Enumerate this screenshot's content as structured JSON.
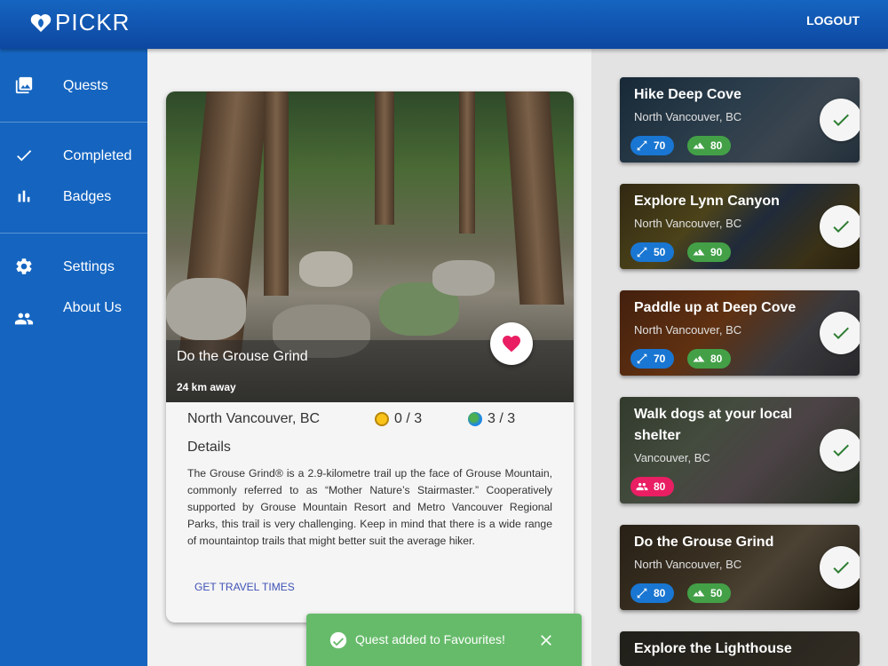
{
  "app": {
    "name": "PICKR",
    "logout": "LOGOUT"
  },
  "sidebar": {
    "items": [
      {
        "label": "Quests",
        "icon": "photo-library-icon"
      },
      {
        "label": "Completed",
        "icon": "check-icon"
      },
      {
        "label": "Badges",
        "icon": "bar-chart-icon"
      },
      {
        "label": "Settings",
        "icon": "gear-icon"
      },
      {
        "label": "About Us",
        "icon": "people-icon"
      }
    ]
  },
  "quest": {
    "title": "Do the Grouse Grind",
    "distance": "24 km away",
    "location": "North Vancouver, BC",
    "medals": "0 / 3",
    "globe": "3 / 3",
    "details_heading": "Details",
    "details": "The Grouse Grind® is a 2.9-kilometre trail up the face of Grouse Mountain, commonly referred to as “Mother Nature’s Stairmaster.” Cooperatively supported by Grouse Mountain Resort and Metro Vancouver Regional Parks, this trail is very challenging. Keep in mind that there is a wide range of mountaintop trails that might better suit the average hiker.",
    "travel_link": "GET TRAVEL TIMES",
    "favourite": true
  },
  "quest_list": [
    {
      "title": "Hike Deep Cove",
      "location": "North Vancouver, BC",
      "distance_score": "70",
      "elevation_score": "80"
    },
    {
      "title": "Explore Lynn Canyon",
      "location": "North Vancouver, BC",
      "distance_score": "50",
      "elevation_score": "90"
    },
    {
      "title": "Paddle up at Deep Cove",
      "location": "North Vancouver, BC",
      "distance_score": "70",
      "elevation_score": "80"
    },
    {
      "title": "Walk dogs at your local shelter",
      "location": "Vancouver, BC",
      "social_score": "80"
    },
    {
      "title": "Do the Grouse Grind",
      "location": "North Vancouver, BC",
      "distance_score": "80",
      "elevation_score": "50"
    },
    {
      "title": "Explore the Lighthouse"
    }
  ],
  "toast": {
    "message": "Quest added to Favourites!"
  },
  "colors": {
    "primary": "#1565c0",
    "success": "#66bb6a",
    "heart": "#e91e63",
    "chip_blue": "#1976d2",
    "chip_green": "#43a047"
  }
}
